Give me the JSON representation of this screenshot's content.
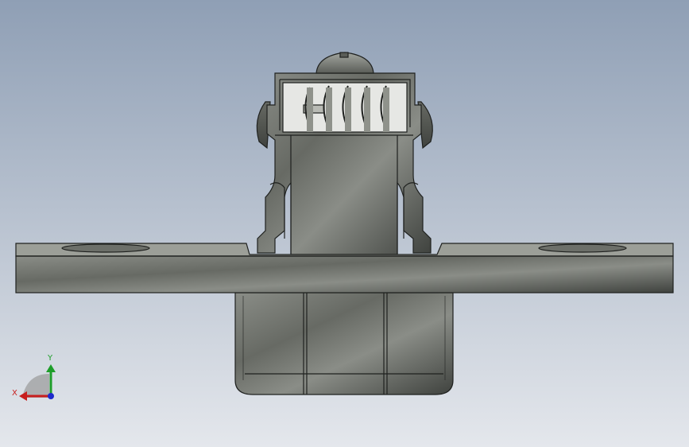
{
  "viewport": {
    "background_top": "#8f9fb5",
    "background_bottom": "#e4e7ec"
  },
  "part": {
    "metal_light": "#8a8d87",
    "metal_mid": "#676a64",
    "metal_dark": "#3f423e",
    "edge_color": "#1f211f"
  },
  "triad": {
    "x_label": "X",
    "y_label": "Y",
    "x_color": "#c81e1e",
    "y_color": "#1e9e2a",
    "z_color": "#1e2acb"
  }
}
